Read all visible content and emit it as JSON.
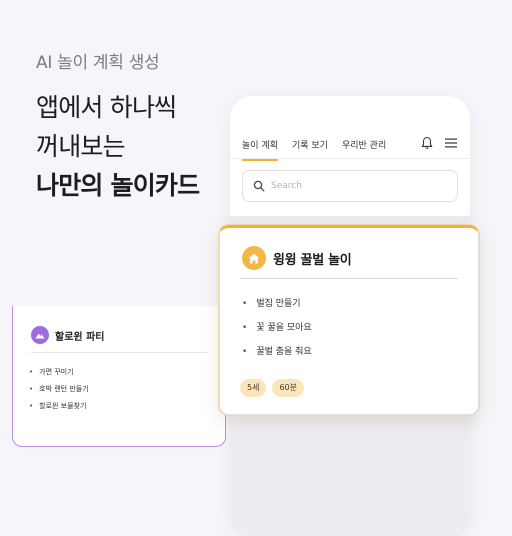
{
  "promo": {
    "eyebrow": "AI 놀이 계획 생성",
    "headline_line1": "앱에서 하나씩",
    "headline_line2": "꺼내보는",
    "headline_line3": "나만의 놀이카드"
  },
  "app": {
    "tabs": [
      {
        "label": "놀이 계획",
        "active": true
      },
      {
        "label": "기록 보기",
        "active": false
      },
      {
        "label": "우리반 관리",
        "active": false
      }
    ],
    "icons": {
      "bell": "bell-icon",
      "menu": "hamburger-menu-icon",
      "search": "search-icon"
    },
    "search": {
      "placeholder": "Search",
      "value": ""
    },
    "accent_color": "#f2b233",
    "secondary_accent_color": "#9c6ce0"
  },
  "cards": [
    {
      "icon": "home-icon",
      "title": "윙윙 꿀벌 놀이",
      "items": [
        "벌집 만들기",
        "꽃 꿀을 모아요",
        "꿀벌 춤을 춰요"
      ],
      "tags": [
        "5세",
        "60분"
      ]
    },
    {
      "icon": "mountain-icon",
      "title": "할로윈 파티",
      "items": [
        "가면 꾸미기",
        "호박 랜턴 만들기",
        "할로윈 보물찾기"
      ]
    }
  ]
}
